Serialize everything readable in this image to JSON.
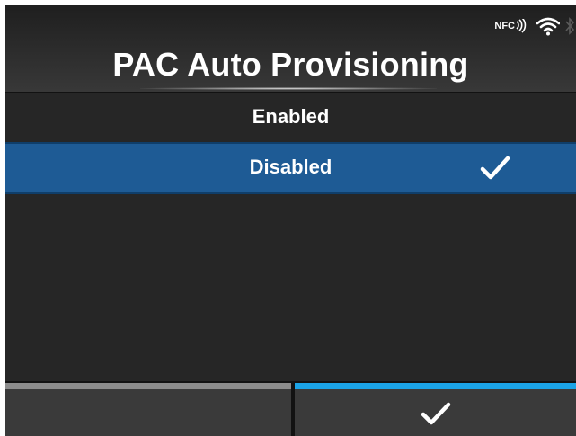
{
  "header": {
    "title": "PAC Auto Provisioning",
    "status_icons": {
      "nfc_label": "NFC",
      "icons": [
        "nfc-icon",
        "wifi-icon",
        "bluetooth-icon"
      ]
    }
  },
  "options": {
    "items": [
      {
        "label": "Enabled",
        "selected": false
      },
      {
        "label": "Disabled",
        "selected": true
      }
    ]
  },
  "footer": {
    "left_button": {
      "icon": ""
    },
    "right_button": {
      "icon": "checkmark-icon"
    }
  },
  "colors": {
    "background": "#262626",
    "selected_row": "#1e5b95",
    "confirm_accent": "#1ba3e6",
    "left_button_accent": "#8c8c8c"
  }
}
